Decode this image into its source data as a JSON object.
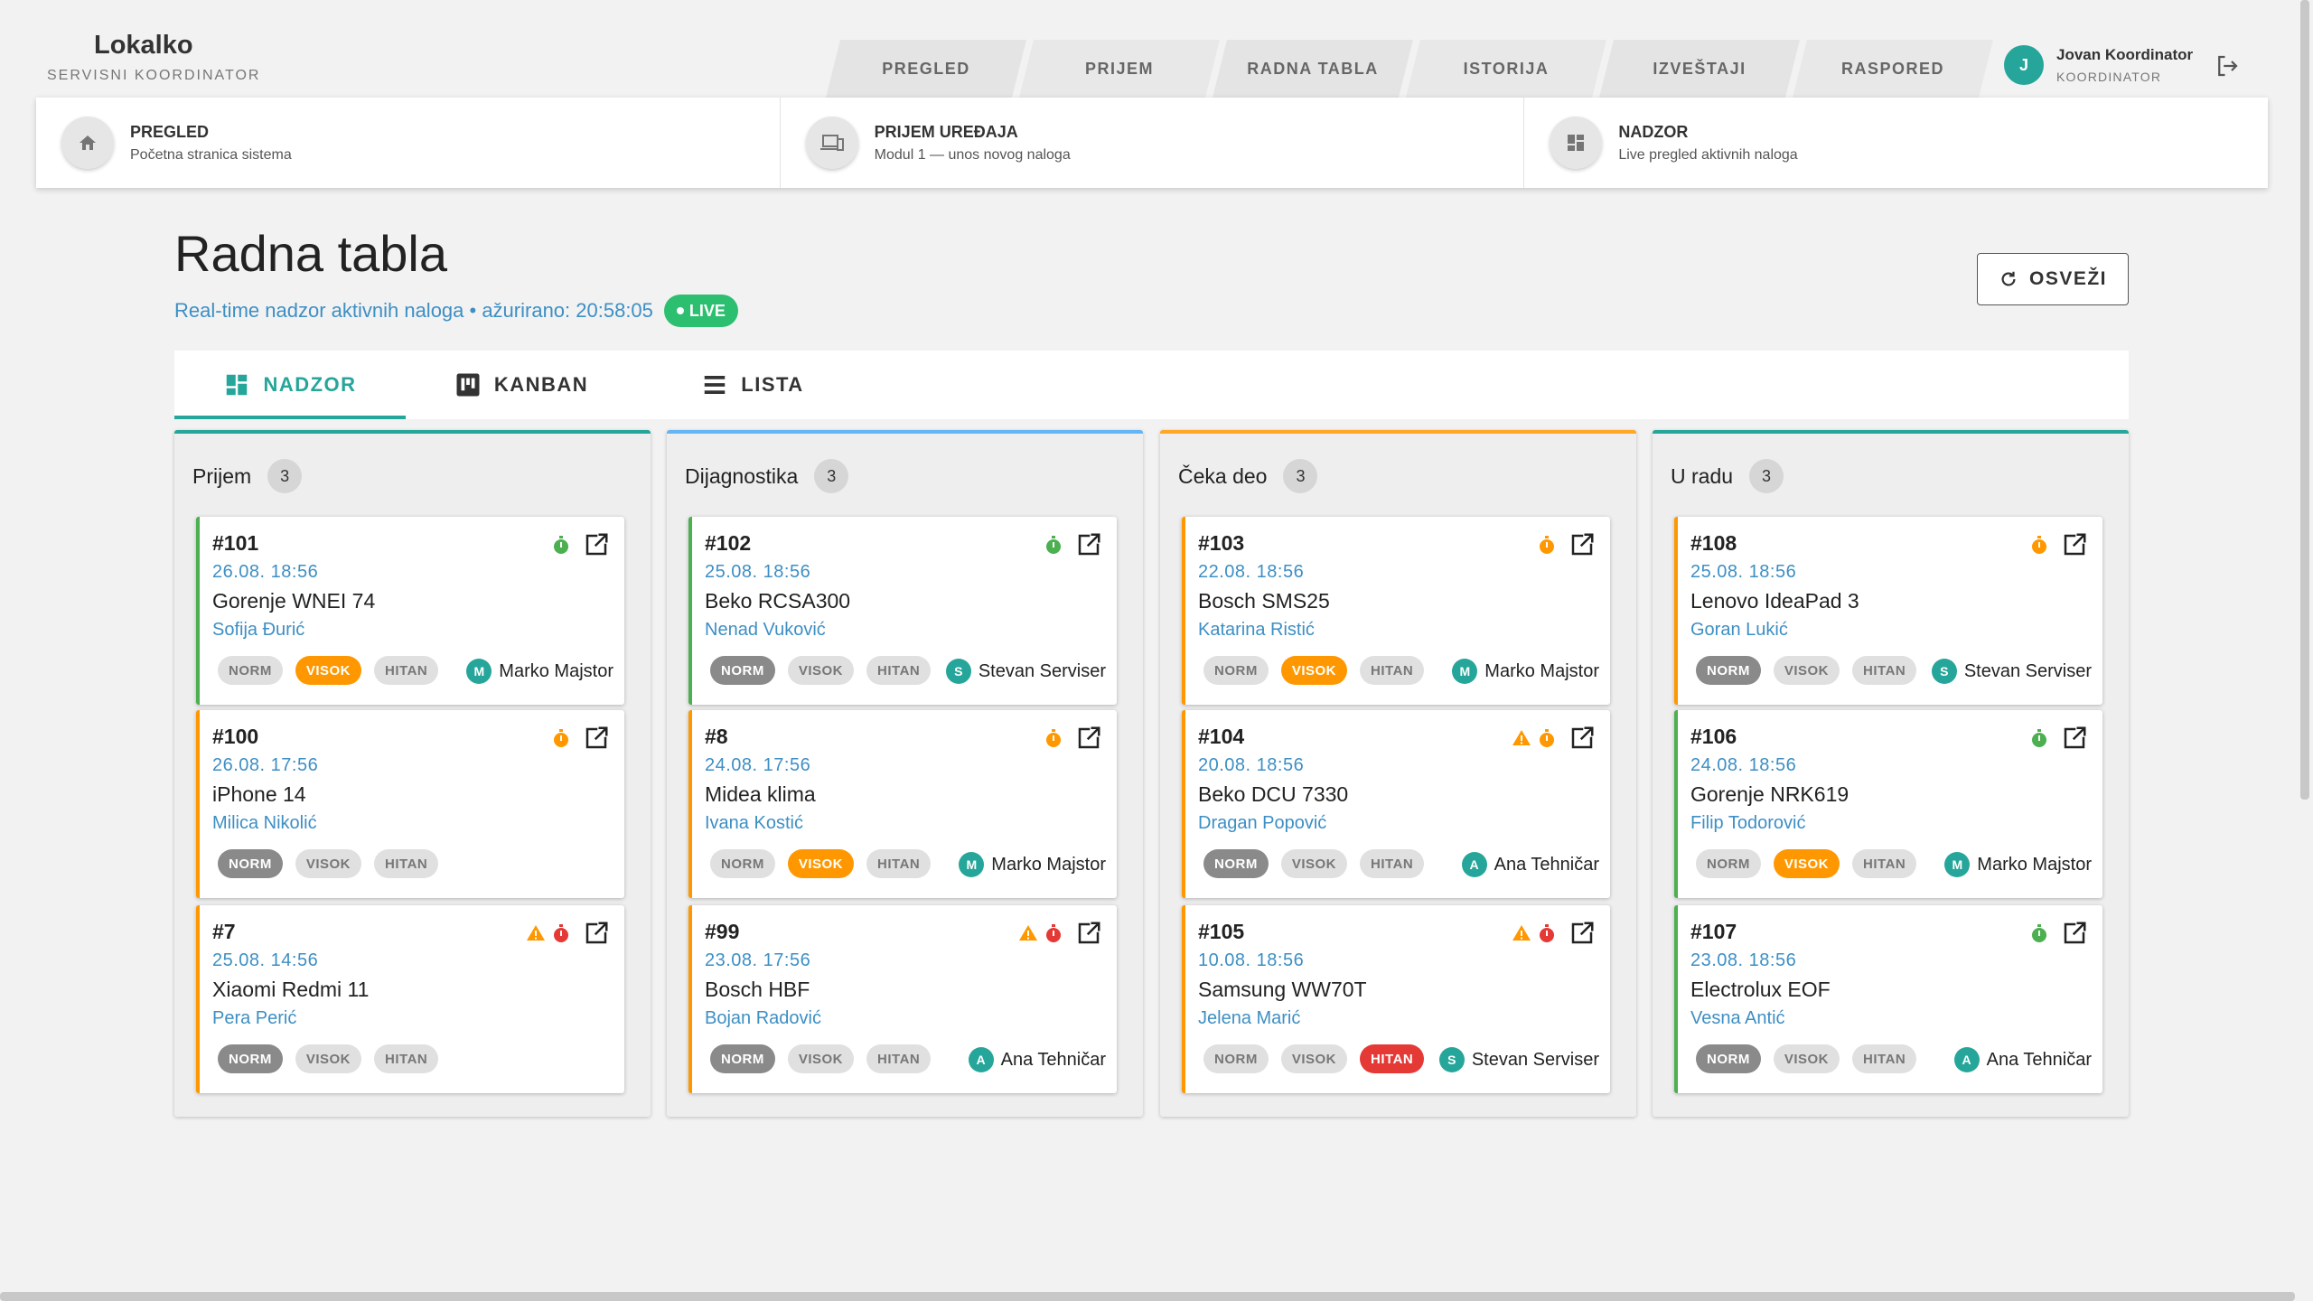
{
  "brand": {
    "title": "Lokalko",
    "subtitle": "SERVISNI KOORDINATOR"
  },
  "nav": [
    "PREGLED",
    "PRIJEM",
    "RADNA TABLA",
    "ISTORIJA",
    "IZVEŠTAJI",
    "RASPORED"
  ],
  "user": {
    "initial": "J",
    "name": "Jovan Koordinator",
    "role": "KOORDINATOR"
  },
  "modules": [
    {
      "title": "PREGLED",
      "sub": "Početna stranica sistema",
      "icon": "home-icon"
    },
    {
      "title": "PRIJEM UREĐAJA",
      "sub": "Modul 1 — unos novog naloga",
      "icon": "devices-icon"
    },
    {
      "title": "NADZOR",
      "sub": "Live pregled aktivnih naloga",
      "icon": "dashboard-icon"
    }
  ],
  "page": {
    "title": "Radna tabla",
    "subtitle": "Real-time nadzor aktivnih naloga • ažurirano: 20:58:05",
    "live": "LIVE",
    "refresh": "OSVEŽI"
  },
  "view_tabs": [
    {
      "label": "NADZOR",
      "icon": "dashboard-icon",
      "active": true
    },
    {
      "label": "KANBAN",
      "icon": "kanban-icon",
      "active": false
    },
    {
      "label": "LISTA",
      "icon": "list-icon",
      "active": false
    }
  ],
  "priority_labels": [
    "NORM",
    "VISOK",
    "HITAN"
  ],
  "colors": {
    "accent": "#26a69a",
    "link": "#3d8fc4",
    "green": "#4caf50",
    "orange": "#ff9800",
    "red": "#e53935",
    "blue": "#64b5f6"
  },
  "columns": [
    {
      "title": "Prijem",
      "count": "3",
      "color": "#26a69a",
      "cards": [
        {
          "id": "#101",
          "date": "26.08. 18:56",
          "device": "Gorenje WNEI 74",
          "client": "Sofija Đurić",
          "priority": "VISOK",
          "tech_initial": "M",
          "tech": "Marko Majstor",
          "timer": "green",
          "warning": false,
          "border": "green"
        },
        {
          "id": "#100",
          "date": "26.08. 17:56",
          "device": "iPhone 14",
          "client": "Milica Nikolić",
          "priority": "NORM",
          "tech_initial": "",
          "tech": "",
          "timer": "orange",
          "warning": false,
          "border": "orange"
        },
        {
          "id": "#7",
          "date": "25.08. 14:56",
          "device": "Xiaomi Redmi 11",
          "client": "Pera Perić",
          "priority": "NORM",
          "tech_initial": "",
          "tech": "",
          "timer": "red",
          "warning": true,
          "border": "orange"
        }
      ]
    },
    {
      "title": "Dijagnostika",
      "count": "3",
      "color": "#64b5f6",
      "cards": [
        {
          "id": "#102",
          "date": "25.08. 18:56",
          "device": "Beko RCSA300",
          "client": "Nenad Vuković",
          "priority": "NORM",
          "tech_initial": "S",
          "tech": "Stevan Serviser",
          "timer": "green",
          "warning": false,
          "border": "green"
        },
        {
          "id": "#8",
          "date": "24.08. 17:56",
          "device": "Midea klima",
          "client": "Ivana Kostić",
          "priority": "VISOK",
          "tech_initial": "M",
          "tech": "Marko Majstor",
          "timer": "orange",
          "warning": false,
          "border": "orange"
        },
        {
          "id": "#99",
          "date": "23.08. 17:56",
          "device": "Bosch HBF",
          "client": "Bojan Radović",
          "priority": "NORM",
          "tech_initial": "A",
          "tech": "Ana Tehničar",
          "timer": "red",
          "warning": true,
          "border": "orange"
        }
      ]
    },
    {
      "title": "Čeka deo",
      "count": "3",
      "color": "#ffa726",
      "cards": [
        {
          "id": "#103",
          "date": "22.08. 18:56",
          "device": "Bosch SMS25",
          "client": "Katarina Ristić",
          "priority": "VISOK",
          "tech_initial": "M",
          "tech": "Marko Majstor",
          "timer": "orange",
          "warning": false,
          "border": "orange"
        },
        {
          "id": "#104",
          "date": "20.08. 18:56",
          "device": "Beko DCU 7330",
          "client": "Dragan Popović",
          "priority": "NORM",
          "tech_initial": "A",
          "tech": "Ana Tehničar",
          "timer": "orange",
          "warning": true,
          "border": "orange"
        },
        {
          "id": "#105",
          "date": "10.08. 18:56",
          "device": "Samsung WW70T",
          "client": "Jelena Marić",
          "priority": "HITAN",
          "tech_initial": "S",
          "tech": "Stevan Serviser",
          "timer": "red",
          "warning": true,
          "border": "orange"
        }
      ]
    },
    {
      "title": "U radu",
      "count": "3",
      "color": "#26a69a",
      "cards": [
        {
          "id": "#108",
          "date": "25.08. 18:56",
          "device": "Lenovo IdeaPad 3",
          "client": "Goran Lukić",
          "priority": "NORM",
          "tech_initial": "S",
          "tech": "Stevan Serviser",
          "timer": "orange",
          "warning": false,
          "border": "orange"
        },
        {
          "id": "#106",
          "date": "24.08. 18:56",
          "device": "Gorenje NRK619",
          "client": "Filip Todorović",
          "priority": "VISOK",
          "tech_initial": "M",
          "tech": "Marko Majstor",
          "timer": "green",
          "warning": false,
          "border": "green"
        },
        {
          "id": "#107",
          "date": "23.08. 18:56",
          "device": "Electrolux EOF",
          "client": "Vesna Antić",
          "priority": "NORM",
          "tech_initial": "A",
          "tech": "Ana Tehničar",
          "timer": "green",
          "warning": false,
          "border": "green"
        }
      ]
    }
  ]
}
